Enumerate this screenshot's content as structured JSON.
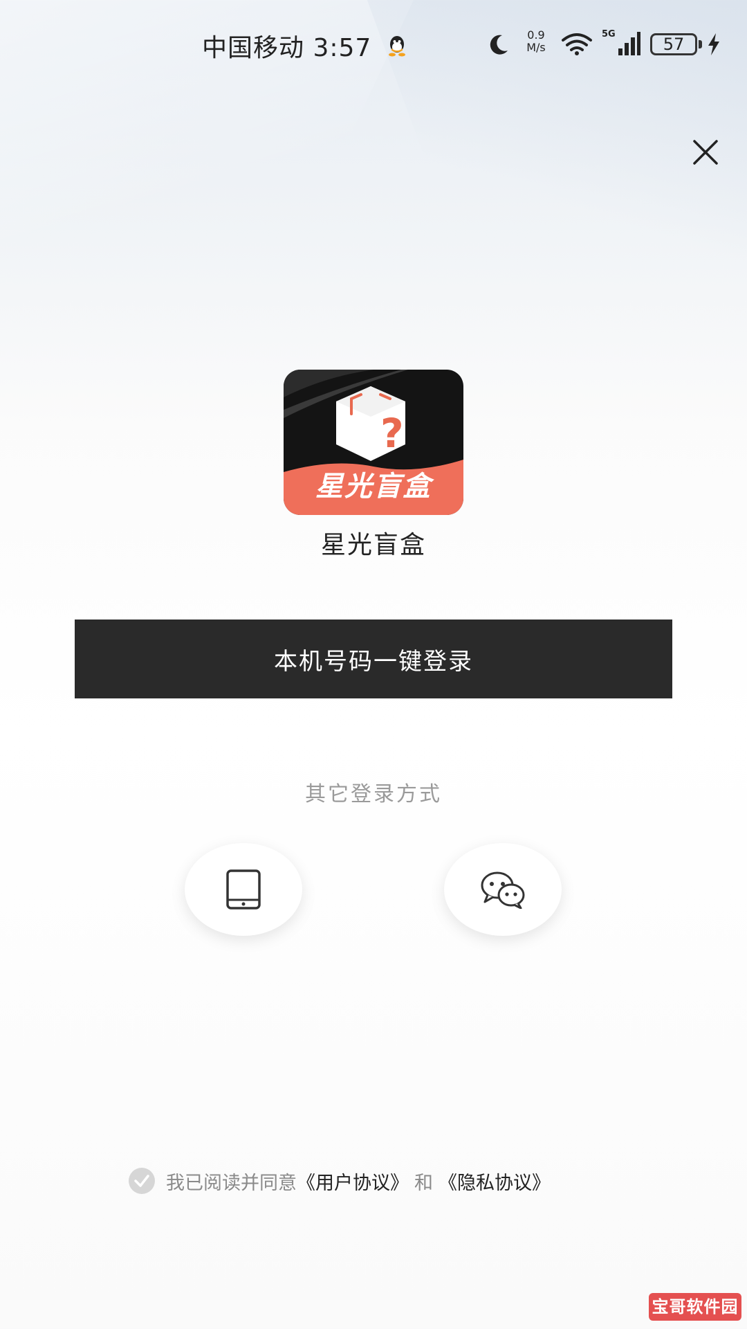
{
  "status_bar": {
    "carrier_time": "中国移动 3:57",
    "net_speed_value": "0.9",
    "net_speed_unit": "M/s",
    "network_type": "5G",
    "battery_level": "57",
    "icons": [
      "qq-icon",
      "moon-icon",
      "wifi-icon",
      "signal-icon",
      "charging-icon"
    ]
  },
  "header": {
    "close_icon": "close-icon"
  },
  "app": {
    "logo_text": "星光盲盒",
    "name": "星光盲盒"
  },
  "login": {
    "one_click_label": "本机号码一键登录",
    "other_methods_label": "其它登录方式",
    "methods": [
      "phone-icon",
      "wechat-icon"
    ]
  },
  "agreement": {
    "checked": true,
    "prefix": "我已阅读并同意",
    "user_agreement": "《用户协议》",
    "conjunction": "和",
    "privacy_agreement": "《隐私协议》"
  },
  "watermark": {
    "text": "宝哥软件园"
  },
  "colors": {
    "primary_button": "#2a2a2a",
    "logo_banner": "#ef6f5a",
    "muted_text": "#9a9a9a",
    "watermark": "#e45050"
  }
}
